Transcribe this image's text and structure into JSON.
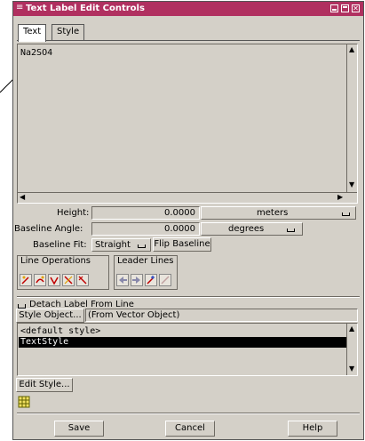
{
  "window": {
    "title": "Text Label Edit Controls",
    "menu_glyph": "≡"
  },
  "tabs": [
    {
      "label": "Text",
      "active": true
    },
    {
      "label": "Style",
      "active": false
    }
  ],
  "text_content": "Na2SO4",
  "height": {
    "label": "Height:",
    "value": "0.0000",
    "unit": "meters"
  },
  "baseline_angle": {
    "label": "Baseline Angle:",
    "value": "0.0000",
    "unit": "degrees"
  },
  "baseline_fit": {
    "label": "Baseline Fit:",
    "value": "Straight",
    "flip_label": "Flip Baseline"
  },
  "line_operations": {
    "title": "Line Operations",
    "tools": [
      "line-op-1-icon",
      "line-op-2-icon",
      "line-op-3-icon",
      "line-op-4-icon",
      "line-op-5-icon"
    ]
  },
  "leader_lines": {
    "title": "Leader Lines",
    "tools": [
      "leader-left-icon",
      "leader-right-icon",
      "leader-add-icon",
      "leader-draw-icon"
    ]
  },
  "detach_label": {
    "label": "Detach Label From Line",
    "checked": false
  },
  "style_object": {
    "button": "Style Object...",
    "value": "(From Vector Object)"
  },
  "style_list": {
    "items": [
      "<default style>",
      "TextStyle"
    ],
    "selected_index": 1
  },
  "edit_style_label": "Edit Style...",
  "footer": {
    "save": "Save",
    "cancel": "Cancel",
    "help": "Help"
  },
  "colors": {
    "titlebar": "#b03060",
    "panel": "#d4d0c8",
    "selection": "#000000"
  }
}
